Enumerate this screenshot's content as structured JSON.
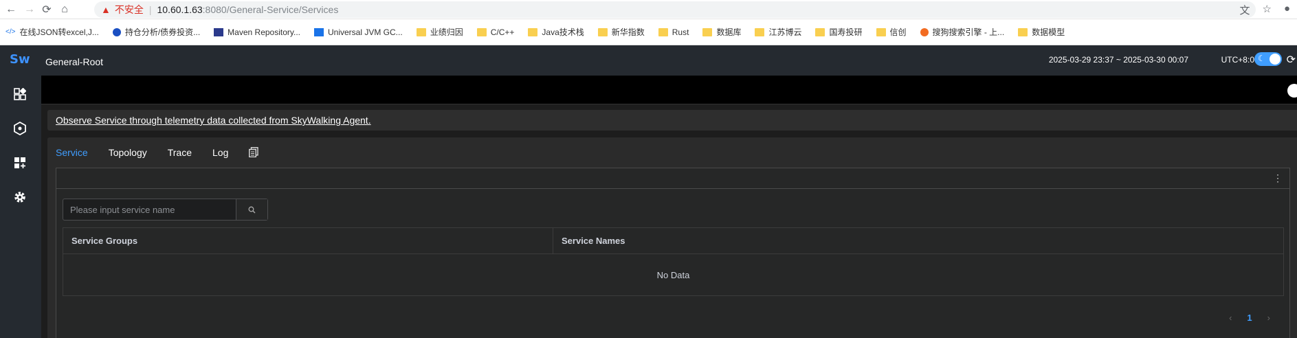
{
  "browser": {
    "insecure_label": "不安全",
    "url_host": "10.60.1.63",
    "url_path": ":8080/General-Service/Services"
  },
  "bookmarks": [
    {
      "label": "在线JSON转excel,J...",
      "icon": "code-icon"
    },
    {
      "label": "持仓分析/债券投资...",
      "icon": "blue-circle-icon"
    },
    {
      "label": "Maven Repository...",
      "icon": "mvn-icon"
    },
    {
      "label": "Universal JVM GC...",
      "icon": "gc-icon"
    },
    {
      "label": "业绩归因",
      "icon": "folder-icon"
    },
    {
      "label": "C/C++",
      "icon": "folder-icon"
    },
    {
      "label": "Java技术栈",
      "icon": "folder-icon"
    },
    {
      "label": "新华指数",
      "icon": "folder-icon"
    },
    {
      "label": "Rust",
      "icon": "folder-icon"
    },
    {
      "label": "数据库",
      "icon": "folder-icon"
    },
    {
      "label": "江苏博云",
      "icon": "folder-icon"
    },
    {
      "label": "国寿投研",
      "icon": "folder-icon"
    },
    {
      "label": "信创",
      "icon": "folder-icon"
    },
    {
      "label": "搜狗搜索引擎 - 上...",
      "icon": "sogou-icon"
    },
    {
      "label": "数据模型",
      "icon": "folder-icon"
    }
  ],
  "app": {
    "logo": "Sw",
    "root_title": "General-Root",
    "time_range": "2025-03-29 23:37 ~ 2025-03-30 00:07",
    "timezone": "UTC+8:0",
    "notice": "Observe Service through telemetry data collected from SkyWalking Agent.",
    "tabs": [
      "Service",
      "Topology",
      "Trace",
      "Log"
    ],
    "search_placeholder": "Please input service name",
    "table": {
      "col_groups": "Service Groups",
      "col_names": "Service Names",
      "empty": "No Data"
    },
    "page": "1"
  },
  "colors": {
    "accent": "#409eff",
    "sidebar": "#252a30"
  }
}
